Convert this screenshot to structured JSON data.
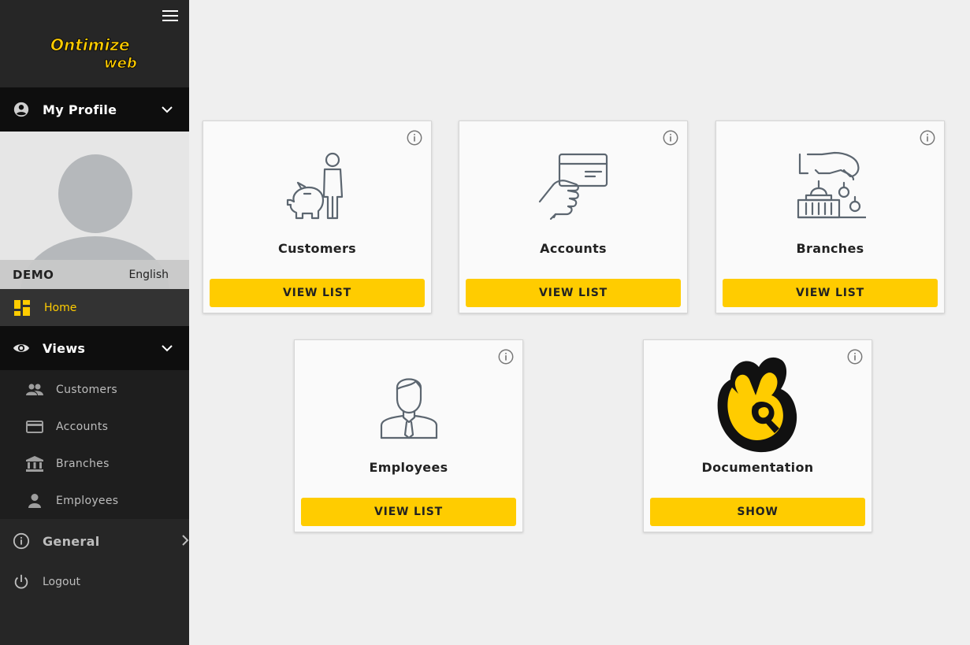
{
  "app": {
    "logo_text_top": "Ontimize",
    "logo_text_bottom": "web"
  },
  "sidebar": {
    "profile_header": "My Profile",
    "user_name": "DEMO",
    "language": "English",
    "home_label": "Home",
    "views_header": "Views",
    "views_items": [
      {
        "label": "Customers",
        "icon": "people-icon"
      },
      {
        "label": "Accounts",
        "icon": "credit-card-icon"
      },
      {
        "label": "Branches",
        "icon": "bank-icon"
      },
      {
        "label": "Employees",
        "icon": "person-icon"
      }
    ],
    "general_header": "General",
    "logout_label": "Logout"
  },
  "cards": [
    {
      "title": "Customers",
      "button": "VIEW LIST",
      "icon": "piggy-bank-person-icon"
    },
    {
      "title": "Accounts",
      "button": "VIEW LIST",
      "icon": "hand-card-icon"
    },
    {
      "title": "Branches",
      "button": "VIEW LIST",
      "icon": "bank-hand-coins-icon"
    },
    {
      "title": "Employees",
      "button": "VIEW LIST",
      "icon": "employee-icon"
    },
    {
      "title": "Documentation",
      "button": "SHOW",
      "icon": "ontimize-hand-icon"
    }
  ],
  "colors": {
    "accent": "#ffcc00",
    "sidebar_bg": "#262626",
    "header_bg": "#0e0e0e",
    "content_bg": "#efefef"
  }
}
